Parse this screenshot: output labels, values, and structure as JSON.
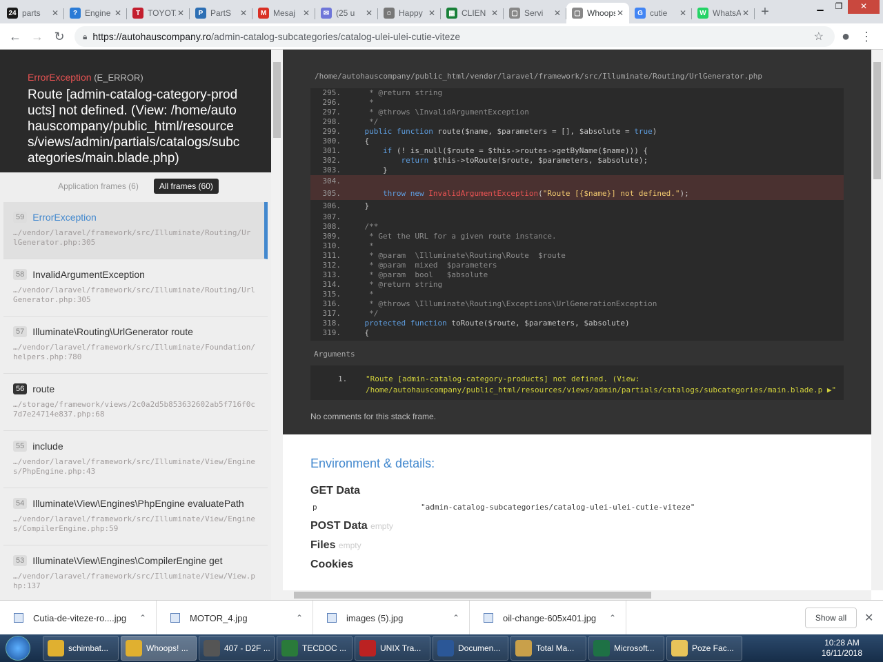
{
  "browser": {
    "tabs": [
      {
        "favicon": "24",
        "favicon_color": "#1a1a1a",
        "title": "parts"
      },
      {
        "favicon": "?",
        "favicon_color": "#2b7bd6",
        "title": "Engine"
      },
      {
        "favicon": "T",
        "favicon_color": "#c31e2e",
        "title": "TOYOTA"
      },
      {
        "favicon": "P",
        "favicon_color": "#2d6fb4",
        "title": "PartS"
      },
      {
        "favicon": "M",
        "favicon_color": "#d93025",
        "title": "Mesaj"
      },
      {
        "favicon": "✉",
        "favicon_color": "#6f76d9",
        "title": "(25 u"
      },
      {
        "favicon": "☺",
        "favicon_color": "#777777",
        "title": "Happy"
      },
      {
        "favicon": "▦",
        "favicon_color": "#188038",
        "title": "CLIEN"
      },
      {
        "favicon": "▢",
        "favicon_color": "#888888",
        "title": "Servi"
      },
      {
        "favicon": "▢",
        "favicon_color": "#888888",
        "title": "Whoops!",
        "active": true
      },
      {
        "favicon": "G",
        "favicon_color": "#4285f4",
        "title": "cutie"
      },
      {
        "favicon": "W",
        "favicon_color": "#25d366",
        "title": "WhatsApp"
      }
    ],
    "url_host": "https://autohauscompany.ro",
    "url_path": "/admin-catalog-subcategories/catalog-ulei-ulei-cutie-viteze"
  },
  "exception": {
    "class": "ErrorException",
    "type": "(E_ERROR)",
    "message": "Route [admin-catalog-category-products] not defined. (View: /home/autohauscompany/public_html/resources/views/admin/partials/catalogs/subcategories/main.blade.php)"
  },
  "frame_filter": {
    "application": "Application frames (6)",
    "all": "All frames (60)"
  },
  "frames": [
    {
      "index": "59",
      "class": "ErrorException",
      "file": "…/vendor/laravel/framework/src/Illuminate/Routing/UrlGenerator.php",
      "line": "305",
      "active": true
    },
    {
      "index": "58",
      "class": "InvalidArgumentException",
      "file": "…/vendor/laravel/framework/src/Illuminate/Routing/UrlGenerator.php",
      "line": "305"
    },
    {
      "index": "57",
      "class": "Illuminate\\Routing\\UrlGenerator route",
      "file": "…/vendor/laravel/framework/src/Illuminate/Foundation/helpers.php",
      "line": "780"
    },
    {
      "index": "56",
      "class": "route",
      "file": "…/storage/framework/views/2c0a2d5b853632602ab5f716f0c7d7e24714e837.php",
      "line": "68",
      "app": true
    },
    {
      "index": "55",
      "class": "include",
      "file": "…/vendor/laravel/framework/src/Illuminate/View/Engines/PhpEngine.php",
      "line": "43"
    },
    {
      "index": "54",
      "class": "Illuminate\\View\\Engines\\PhpEngine evaluatePath",
      "file": "…/vendor/laravel/framework/src/Illuminate/View/Engines/CompilerEngine.php",
      "line": "59"
    },
    {
      "index": "53",
      "class": "Illuminate\\View\\Engines\\CompilerEngine get",
      "file": "…/vendor/laravel/framework/src/Illuminate/View/View.php",
      "line": "137"
    }
  ],
  "code": {
    "file_path": "/home/autohauscompany/public_html/vendor/laravel/framework/src/Illuminate/Routing/UrlGenerator.php",
    "lines": [
      {
        "n": "295.",
        "html": "<span class=\"cm\">     * @return string</span>"
      },
      {
        "n": "296.",
        "html": "<span class=\"cm\">     *</span>"
      },
      {
        "n": "297.",
        "html": "<span class=\"cm\">     * @throws \\InvalidArgumentException</span>"
      },
      {
        "n": "298.",
        "html": "<span class=\"cm\">     */</span>"
      },
      {
        "n": "299.",
        "html": "    <span class=\"kw\">public function</span> route($name, $parameters = [], $absolute = <span class=\"kw\">true</span>)"
      },
      {
        "n": "300.",
        "html": "    {"
      },
      {
        "n": "301.",
        "html": "        <span class=\"kw\">if</span> (! is_null($route = $this->routes->getByName($name))) {"
      },
      {
        "n": "302.",
        "html": "            <span class=\"kw\">return</span> $this->toRoute($route, $parameters, $absolute);"
      },
      {
        "n": "303.",
        "html": "        }"
      },
      {
        "n": "304.",
        "html": "",
        "hl": true,
        "gap": true
      },
      {
        "n": "305.",
        "html": "        <span class=\"kw\">throw new</span> <span class=\"err\">InvalidArgumentException</span>(<span class=\"str\">\"Route [{$name}] not defined.\"</span>);",
        "hl": true,
        "gap": true
      },
      {
        "n": "306.",
        "html": "    }",
        "gap": true
      },
      {
        "n": "307.",
        "html": ""
      },
      {
        "n": "308.",
        "html": "<span class=\"cm\">    /**</span>"
      },
      {
        "n": "309.",
        "html": "<span class=\"cm\">     * Get the URL for a given route instance.</span>"
      },
      {
        "n": "310.",
        "html": "<span class=\"cm\">     *</span>"
      },
      {
        "n": "311.",
        "html": "<span class=\"cm\">     * @param  \\Illuminate\\Routing\\Route  $route</span>"
      },
      {
        "n": "312.",
        "html": "<span class=\"cm\">     * @param  mixed  $parameters</span>"
      },
      {
        "n": "313.",
        "html": "<span class=\"cm\">     * @param  bool   $absolute</span>"
      },
      {
        "n": "314.",
        "html": "<span class=\"cm\">     * @return string</span>"
      },
      {
        "n": "315.",
        "html": "<span class=\"cm\">     *</span>"
      },
      {
        "n": "316.",
        "html": "<span class=\"cm\">     * @throws \\Illuminate\\Routing\\Exceptions\\UrlGenerationException</span>"
      },
      {
        "n": "317.",
        "html": "<span class=\"cm\">     */</span>"
      },
      {
        "n": "318.",
        "html": "    <span class=\"kw\">protected function</span> toRoute($route, $parameters, $absolute)"
      },
      {
        "n": "319.",
        "html": "    {"
      }
    ]
  },
  "arguments": {
    "label": "Arguments",
    "number": "1.",
    "value": "\"Route [admin-catalog-category-products] not defined. (View: /home/autohauscompany/public_html/resources/views/admin/partials/catalogs/subcategories/main.blade.p ▶\""
  },
  "no_comments": "No comments for this stack frame.",
  "environment": {
    "title": "Environment & details:",
    "get_data": "GET Data",
    "get_key": "p",
    "get_value": "\"admin-catalog-subcategories/catalog-ulei-ulei-cutie-viteze\"",
    "post_data": "POST Data",
    "files": "Files",
    "cookies": "Cookies",
    "empty": "empty"
  },
  "downloads": {
    "items": [
      "Cutia-de-viteze-ro....jpg",
      "MOTOR_4.jpg",
      "images (5).jpg",
      "oil-change-605x401.jpg"
    ],
    "show_all": "Show all"
  },
  "taskbar": {
    "items": [
      {
        "label": "schimbat...",
        "color": "#e0b030"
      },
      {
        "label": "Whoops! ...",
        "color": "#e0b030",
        "active": true
      },
      {
        "label": "407 - D2F ...",
        "color": "#555"
      },
      {
        "label": "TECDOC ...",
        "color": "#2a7a3a"
      },
      {
        "label": "UNIX Tra...",
        "color": "#b22"
      },
      {
        "label": "Documen...",
        "color": "#2b5797"
      },
      {
        "label": "Total Ma...",
        "color": "#c9a04a"
      },
      {
        "label": "Microsoft...",
        "color": "#1e7145"
      },
      {
        "label": "Poze Fac...",
        "color": "#e8c45a"
      }
    ],
    "time": "10:28 AM",
    "date": "16/11/2018"
  }
}
